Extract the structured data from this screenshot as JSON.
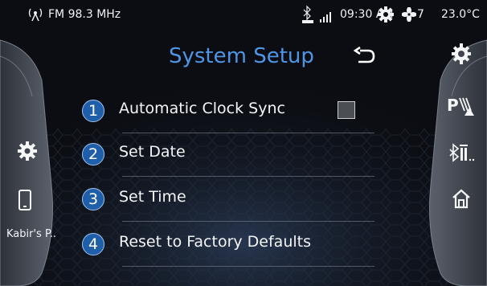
{
  "status_bar": {
    "radio": "FM 98.3 MHz",
    "time": "09:30 AM",
    "fan_speed": "7",
    "temperature": "23.0°C",
    "icons": [
      "radio-antenna-icon",
      "bluetooth-phone-icon",
      "signal-icon",
      "gear-icon",
      "fan-icon"
    ]
  },
  "header": {
    "title": "System Setup",
    "back_icon": "back-arrow-icon"
  },
  "left_panel": {
    "items": [
      {
        "icon": "gear-icon"
      },
      {
        "icon": "phone-icon"
      }
    ],
    "device_name": "Kabir's P.."
  },
  "right_panel": {
    "items": [
      {
        "icon": "gear-icon"
      },
      {
        "icon": "parking-sensor-icon"
      },
      {
        "icon": "bluetooth-audio-icon"
      },
      {
        "icon": "home-icon"
      }
    ]
  },
  "menu": {
    "items": [
      {
        "number": "1",
        "label": "Automatic Clock Sync",
        "checked": false
      },
      {
        "number": "2",
        "label": "Set Date"
      },
      {
        "number": "3",
        "label": "Set Time"
      },
      {
        "number": "4",
        "label": "Reset to Factory Defaults"
      }
    ]
  },
  "colors": {
    "accent": "#4f95e6",
    "badge": "#1f5ea8",
    "background": "#0b0d12",
    "panel": "#4a4f58"
  }
}
